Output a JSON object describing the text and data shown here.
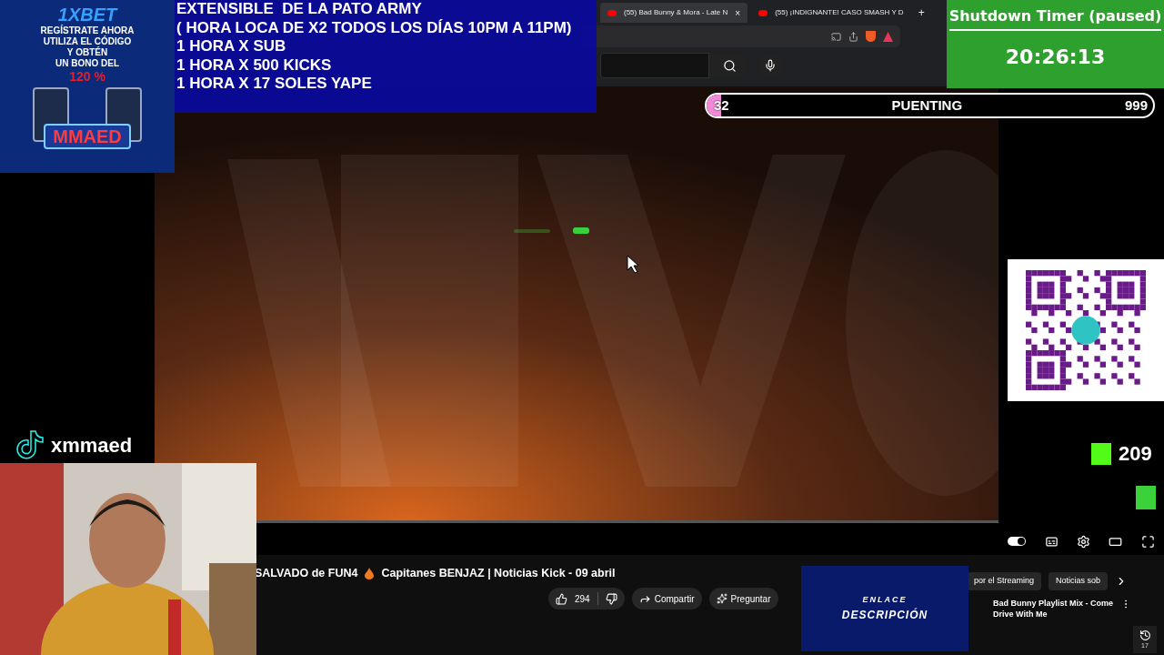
{
  "browser": {
    "tabs": [
      {
        "title": "(55) Bad Bunny & Mora - Late N",
        "selected": true,
        "close": "×"
      },
      {
        "title": "(55) ¡INDIGNANTE! CASO SMASH Y D",
        "selected": false
      }
    ],
    "new_tab": "+"
  },
  "ad": {
    "brand": "1XBET",
    "lines": [
      "REGÍSTRATE AHORA",
      "UTILIZA EL CÓDIGO",
      "Y OBTÉN",
      "UN BONO DEL"
    ],
    "bonus": "120 %",
    "code": "MMAED"
  },
  "announcement": {
    "lines": [
      "EXTENSIBLE  DE LA PATO ARMY",
      "( HORA LOCA DE X2 TODOS LOS DÍAS 10PM A 11PM)",
      "1 HORA X SUB",
      "1 HORA X 500 KICKS",
      "1 HORA X 17 SOLES YAPE"
    ]
  },
  "timer": {
    "title": "Shutdown Timer (paused)",
    "time": "20:26:13"
  },
  "goal": {
    "current": "32",
    "label": "PUENTING",
    "target": "999",
    "level": 0.032
  },
  "tiktok": {
    "handle": "xmmaed"
  },
  "kick": {
    "count": "209"
  },
  "video": {
    "title_start": "SALVADO de FUN4",
    "title_end": "Capitanes BENJAZ | Noticias Kick - 09 abril",
    "likes": "294",
    "actions": [
      {
        "kind": "share",
        "label": "Compartir"
      },
      {
        "kind": "ask",
        "label": "Preguntar"
      }
    ]
  },
  "promo": {
    "line1": "ENLACE",
    "line2": "DESCRIPCIÓN"
  },
  "chips": [
    {
      "label": "por el Streaming",
      "selected": false
    },
    {
      "label": "Noticias sob",
      "selected": false
    }
  ],
  "recommendation": {
    "title": "Bad Bunny Playlist Mix - Come Drive With Me"
  },
  "history_count": "17",
  "player": {
    "autoplay_on": true
  }
}
